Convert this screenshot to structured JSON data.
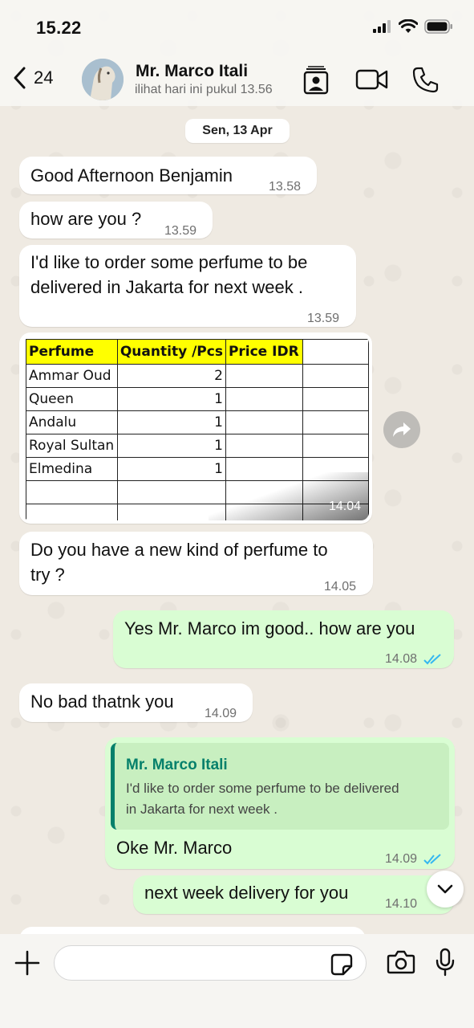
{
  "status_bar": {
    "time": "15.22"
  },
  "header": {
    "back_count": "24",
    "contact_name": "Mr. Marco Itali",
    "last_seen": "ilihat hari ini pukul 13.56"
  },
  "date_chip": "Sen, 13 Apr",
  "messages": [
    {
      "text": "Good Afternoon Benjamin",
      "time": "13.58"
    },
    {
      "text": "how are you ?",
      "time": "13.59"
    },
    {
      "line1": "I'd like to order some perfume to be",
      "line2": "delivered in Jakarta  for next week .",
      "time": "13.59"
    },
    {
      "line1": "Do you have a new kind of perfume to",
      "line2": "try ?",
      "time": "14.05"
    },
    {
      "text": "Yes Mr. Marco im good.. how are you",
      "time": "14.08"
    },
    {
      "text": "No bad thatnk you",
      "time": "14.09"
    },
    {
      "text": "Oke Mr. Marco",
      "time": "14.09",
      "quote_name": "Mr. Marco Itali",
      "quote_line1": "I'd like to order some perfume to be delivered",
      "quote_line2": "in Jakarta  for next week ."
    },
    {
      "text": "next week delivery for you",
      "time": "14.10"
    }
  ],
  "image_message": {
    "time": "14.04",
    "table": {
      "headers": [
        "Perfume",
        "Quantity /Pcs",
        "Price IDR",
        ""
      ],
      "rows": [
        [
          "Ammar Oud",
          "2",
          "",
          ""
        ],
        [
          "Queen",
          "1",
          "",
          ""
        ],
        [
          "Andalu",
          "1",
          "",
          ""
        ],
        [
          "Royal Sultan",
          "1",
          "",
          ""
        ],
        [
          "Elmedina",
          "1",
          "",
          ""
        ],
        [
          "",
          "",
          "",
          ""
        ],
        [
          "",
          "",
          "",
          ""
        ]
      ]
    }
  },
  "colors": {
    "outgoing_bubble": "#d9fdd3",
    "incoming_bubble": "#ffffff",
    "accent_green": "#06806b",
    "read_ticks": "#34b7f1",
    "sheet_header": "#ffff00"
  },
  "icons": [
    "back-chevron-icon",
    "contacts-icon",
    "video-call-icon",
    "phone-icon",
    "forward-icon",
    "chevron-down-icon",
    "plus-icon",
    "sticker-icon",
    "camera-icon",
    "microphone-icon"
  ]
}
